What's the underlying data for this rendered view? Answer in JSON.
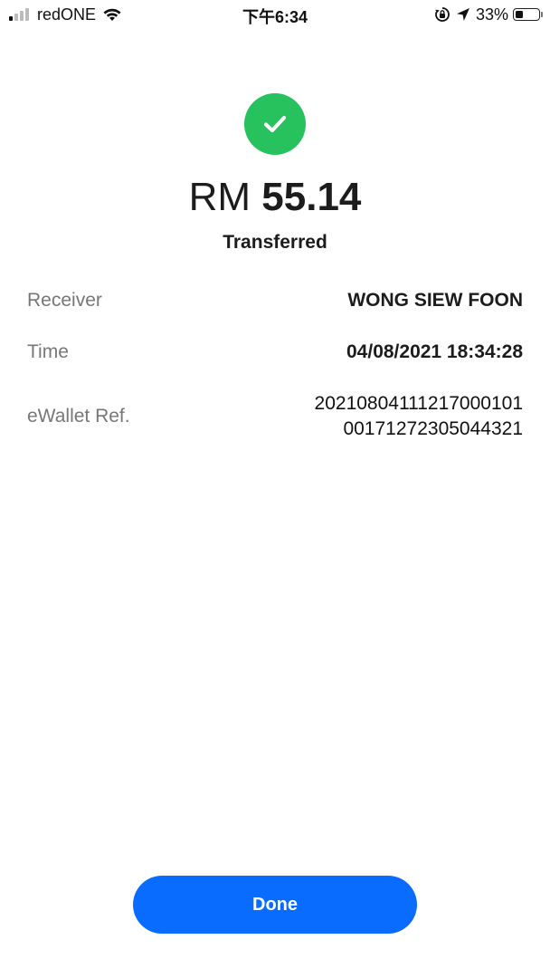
{
  "status_bar": {
    "carrier": "redONE",
    "time": "下午6:34",
    "battery_percent": "33%",
    "battery_level": 0.33,
    "signal_bars_filled": 1,
    "signal_bars_total": 4,
    "icons": [
      "signal-icon",
      "wifi-icon",
      "orientation-lock-icon",
      "location-arrow-icon",
      "battery-icon"
    ]
  },
  "result": {
    "icon": "check-icon",
    "currency": "RM",
    "amount": "55.14",
    "status": "Transferred",
    "accent_color": "#27c15e"
  },
  "details": {
    "receiver_label": "Receiver",
    "receiver_value": "WONG SIEW FOON",
    "time_label": "Time",
    "time_value": "04/08/2021 18:34:28",
    "ref_label": "eWallet Ref.",
    "ref_value_line1": "20210804111217000101",
    "ref_value_line2": "00171272305044321"
  },
  "actions": {
    "done_label": "Done",
    "button_color": "#0a6cff"
  }
}
